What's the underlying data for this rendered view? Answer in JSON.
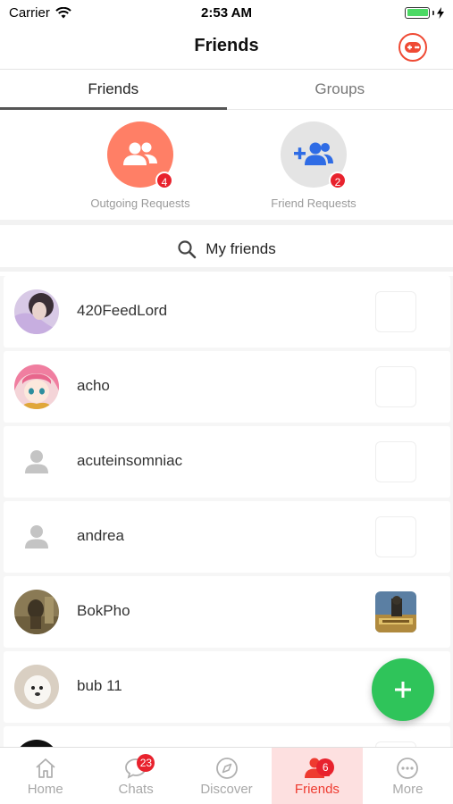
{
  "status_bar": {
    "carrier": "Carrier",
    "time": "2:53 AM"
  },
  "header": {
    "title": "Friends"
  },
  "tabs": [
    {
      "label": "Friends",
      "active": true
    },
    {
      "label": "Groups",
      "active": false
    }
  ],
  "requests": {
    "outgoing": {
      "label": "Outgoing Requests",
      "count": "4",
      "color": "#ff7f66"
    },
    "incoming": {
      "label": "Friend Requests",
      "count": "2",
      "color": "#e4e4e4",
      "icon_color": "#2f6ce5"
    }
  },
  "my_friends": {
    "label": "My friends"
  },
  "friends": [
    {
      "name": "420FeedLord",
      "avatar": "photo-purple",
      "game": "empty"
    },
    {
      "name": "acho",
      "avatar": "anime-pink-hair",
      "game": "empty"
    },
    {
      "name": "acuteinsomniac",
      "avatar": "default-person",
      "game": "empty"
    },
    {
      "name": "andrea",
      "avatar": "default-person",
      "game": "empty"
    },
    {
      "name": "BokPho",
      "avatar": "photo-brown",
      "game": "pubg-thumbnail"
    },
    {
      "name": "bub 11",
      "avatar": "photo-white-dog",
      "game": "empty"
    }
  ],
  "tabbar": {
    "items": [
      {
        "label": "Home",
        "icon": "home-icon"
      },
      {
        "label": "Chats",
        "icon": "chat-icon",
        "badge": "23"
      },
      {
        "label": "Discover",
        "icon": "compass-icon"
      },
      {
        "label": "Friends",
        "icon": "friends-icon",
        "badge": "6",
        "active": true
      },
      {
        "label": "More",
        "icon": "more-icon"
      }
    ]
  },
  "colors": {
    "accent": "#ee3b30",
    "fab": "#2fc45a",
    "badge": "#e8222d"
  }
}
